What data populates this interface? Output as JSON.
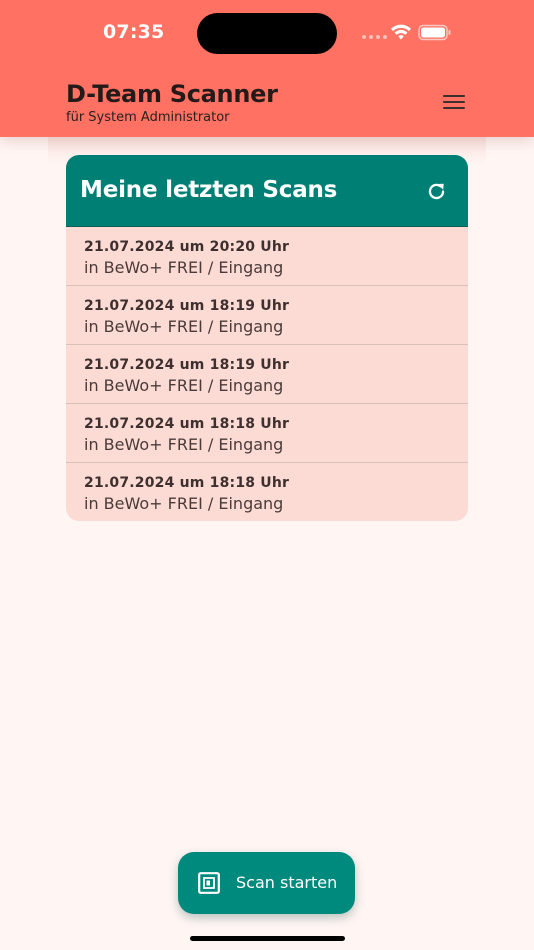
{
  "status_bar": {
    "time": "07:35",
    "wifi_icon": "wifi-icon",
    "battery_icon": "battery-icon"
  },
  "header": {
    "title": "D-Team Scanner",
    "subtitle": "für System Administrator",
    "menu_icon": "hamburger-menu-icon"
  },
  "card": {
    "title": "Meine letzten Scans",
    "refresh_icon": "refresh-icon",
    "scans": [
      {
        "date": "21.07.2024 um 20:20 Uhr",
        "location": "in BeWo+ FREI / Eingang"
      },
      {
        "date": "21.07.2024 um 18:19 Uhr",
        "location": "in BeWo+ FREI / Eingang"
      },
      {
        "date": "21.07.2024 um 18:19 Uhr",
        "location": "in BeWo+ FREI / Eingang"
      },
      {
        "date": "21.07.2024 um 18:18 Uhr",
        "location": "in BeWo+ FREI / Eingang"
      },
      {
        "date": "21.07.2024 um 18:18 Uhr",
        "location": "in BeWo+ FREI / Eingang"
      }
    ]
  },
  "fab": {
    "label": "Scan starten",
    "icon": "scan-icon"
  },
  "colors": {
    "header_bg": "#FF7163",
    "page_bg": "#FFF6F4",
    "card_header_bg": "#008074",
    "card_body_bg": "#FCDBD5",
    "fab_bg": "#00897D"
  }
}
